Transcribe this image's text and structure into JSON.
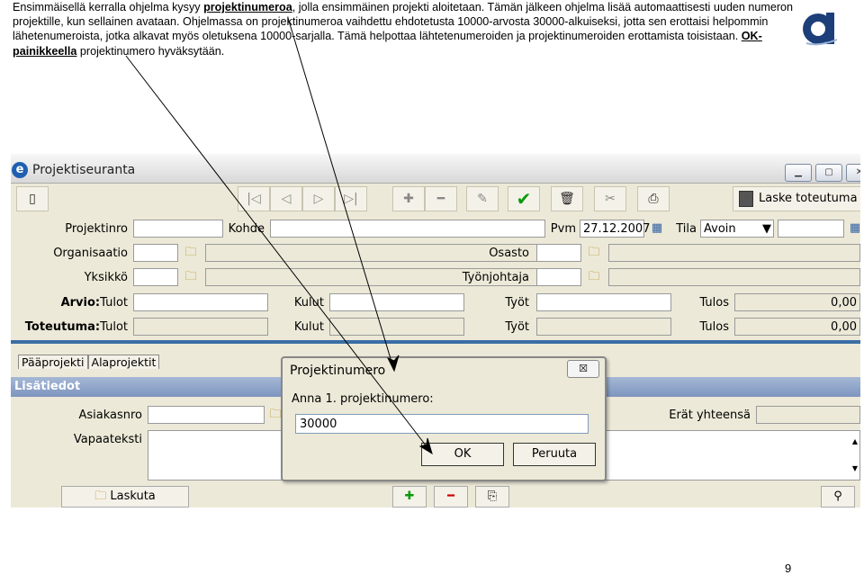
{
  "intro": {
    "part1": "Ensimmäisellä kerralla ohjelma kysyy ",
    "link1": "projektinumeroa",
    "part2": ", jolla ensimmäinen projekti aloitetaan. Tämän jälkeen ohjelma lisää automaattisesti uuden numeron projektille, kun sellainen avataan. Ohjelmassa on projektinumeroa vaihdettu ehdotetusta 10000-arvosta 30000-alkuiseksi, jotta sen erottaisi helpommin lähetenumeroista, jotka alkavat myös oletuksena 10000-sarjalla. Tämä helpottaa lähtetenumeroiden ja projektinumeroiden erottamista toisistaan. ",
    "link2": "OK-painikkeella",
    "part3": " projektinumero hyväksytään."
  },
  "page_number": "9",
  "window": {
    "title": "Projektiseuranta",
    "app_icon": "e",
    "laske_label": "Laske toteutuma"
  },
  "form": {
    "projektinro_label": "Projektinro",
    "kohde_label": "Kohde",
    "pvm_label": "Pvm",
    "pvm_value": "27.12.2007",
    "tila_label": "Tila",
    "tila_value": "Avoin",
    "organisaatio_label": "Organisaatio",
    "osasto_label": "Osasto",
    "yksikko_label": "Yksikkö",
    "tyonjohtaja_label": "Työnjohtaja",
    "arvio_label": "Arvio:",
    "toteutuma_label": "Toteutuma:",
    "tulot_label": "Tulot",
    "kulut_label": "Kulut",
    "tyot_label": "Työt",
    "tulos_label": "Tulos",
    "arvio_tulos": "0,00",
    "toteutuma_tulos": "0,00"
  },
  "tabs": [
    "Pääprojekti",
    "Alaprojektit"
  ],
  "lisatiedot": {
    "header": "Lisätiedot",
    "asiakasnro_label": "Asiakasnro",
    "vapaateksti_label": "Vapaateksti",
    "erat_label": "Erät yhteensä"
  },
  "bottom": {
    "laskuta_label": "Laskuta"
  },
  "dialog": {
    "title": "Projektinumero",
    "close": "☒",
    "prompt": "Anna 1. projektinumero:",
    "value": "30000",
    "ok": "OK",
    "cancel": "Peruuta"
  },
  "colors": {
    "accent_blue": "#3b6ea5",
    "ok_green": "#0a9a0a",
    "logo_blue": "#1c3f7a"
  }
}
